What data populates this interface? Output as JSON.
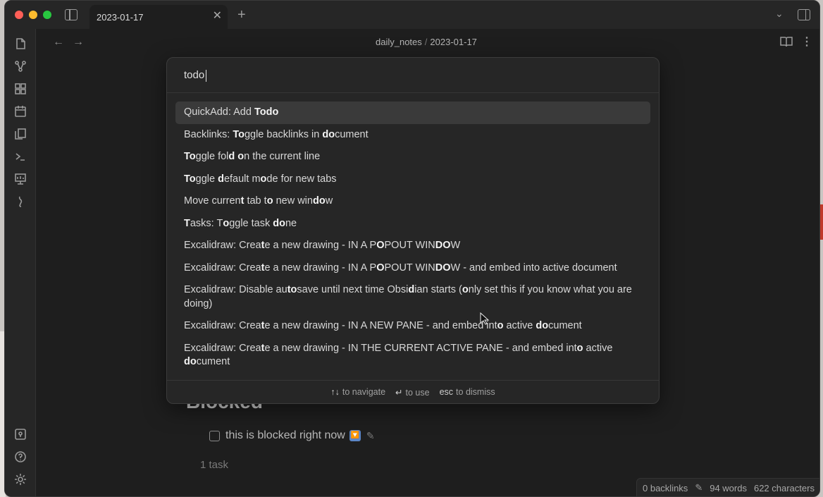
{
  "tab": {
    "title": "2023-01-17",
    "close": "✕",
    "new": "+"
  },
  "header": {
    "folder": "daily_notes",
    "separator": "/",
    "note": "2023-01-17"
  },
  "palette": {
    "query": "todo",
    "suggestions": [
      "QuickAdd: Add <b>Todo</b>",
      "Backlinks: <b>To</b>ggle backlinks in <b>do</b>cument",
      "<b>To</b>ggle fol<b>d</b> <b>o</b>n the current line",
      "<b>To</b>ggle <b>d</b>efault m<b>o</b>de for new tabs",
      "Move curren<b>t</b> tab t<b>o</b> new win<b>do</b>w",
      "<b>T</b>asks: T<b>o</b>ggle task <b>do</b>ne",
      "Excalidraw: Crea<b>t</b>e a new drawing - IN A P<b>O</b>POUT WIN<b>DO</b>W",
      "Excalidraw: Crea<b>t</b>e a new drawing - IN A P<b>O</b>POUT WIN<b>DO</b>W - and embed into active document",
      "Excalidraw: Disable au<b>to</b>save until next time Obsi<b>d</b>ian starts (<b>o</b>nly set this if you know what you are doing)",
      "Excalidraw: Crea<b>t</b>e a new drawing - IN A NEW PANE - and embed int<b>o</b> active <b>do</b>cument",
      "Excalidraw: Crea<b>t</b>e a new drawing - IN THE CURRENT ACTIVE PANE - and embed int<b>o</b> active <b>do</b>cument"
    ],
    "footer": [
      {
        "key": "↑↓",
        "label": "to navigate"
      },
      {
        "key": "↵",
        "label": "to use"
      },
      {
        "key": "esc",
        "label": "to dismiss"
      }
    ]
  },
  "content": {
    "heading": "Blocked",
    "task_text": "this is blocked right now",
    "priority_badge": "🔽",
    "task_count": "1 task"
  },
  "status": {
    "backlinks": "0 backlinks",
    "words": "94 words",
    "characters": "622 characters"
  },
  "colors": {
    "background": "#1e1e1e",
    "panel": "#262626",
    "selected": "#3a3a3a"
  }
}
